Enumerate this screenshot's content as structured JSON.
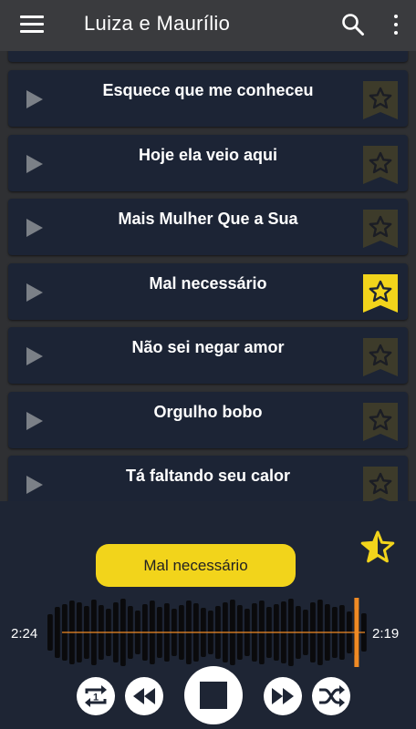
{
  "header": {
    "title": "Luiza e Maurílio",
    "menu_icon": "hamburger-menu-icon",
    "search_icon": "search-icon",
    "more_icon": "more-vert-icon"
  },
  "songs": [
    {
      "title": "Esquece que me conheceu",
      "favorite": false
    },
    {
      "title": "Hoje ela veio aqui",
      "favorite": false
    },
    {
      "title": "Mais Mulher Que a Sua",
      "favorite": false
    },
    {
      "title": "Mal necessário",
      "favorite": true
    },
    {
      "title": "Não sei negar amor",
      "favorite": false
    },
    {
      "title": "Orgulho bobo",
      "favorite": false
    },
    {
      "title": "Tá faltando seu calor",
      "favorite": false
    }
  ],
  "player": {
    "now_playing": "Mal necessário",
    "elapsed": "2:24",
    "remaining": "2:19",
    "progress": 0.98,
    "controls": [
      "repeat-one-icon",
      "rewind-icon",
      "stop-icon",
      "fast-forward-icon",
      "shuffle-icon"
    ]
  },
  "colors": {
    "accent": "#f2d41b",
    "card": "#1c2435",
    "player_bg": "#1e2534",
    "progress": "#f08a24"
  }
}
